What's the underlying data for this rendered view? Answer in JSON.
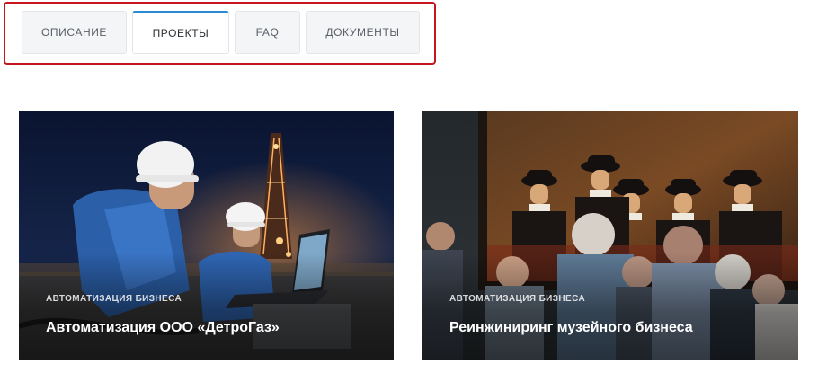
{
  "tabs": [
    {
      "label": "ОПИСАНИЕ",
      "active": false
    },
    {
      "label": "ПРОЕКТЫ",
      "active": true
    },
    {
      "label": "FAQ",
      "active": false
    },
    {
      "label": "ДОКУМЕНТЫ",
      "active": false
    }
  ],
  "colors": {
    "highlight_frame": "#c4161c",
    "active_tab_accent": "#2a8ad4"
  },
  "projects": [
    {
      "category": "АВТОМАТИЗАЦИЯ БИЗНЕСА",
      "title": "Автоматизация ООО «ДетроГаз»",
      "image": "oil-rig-workers-photo"
    },
    {
      "category": "АВТОМАТИЗАЦИЯ БИЗНЕСА",
      "title": "Реинжиниринг музейного бизнеса",
      "image": "museum-visitors-painting-photo"
    }
  ]
}
